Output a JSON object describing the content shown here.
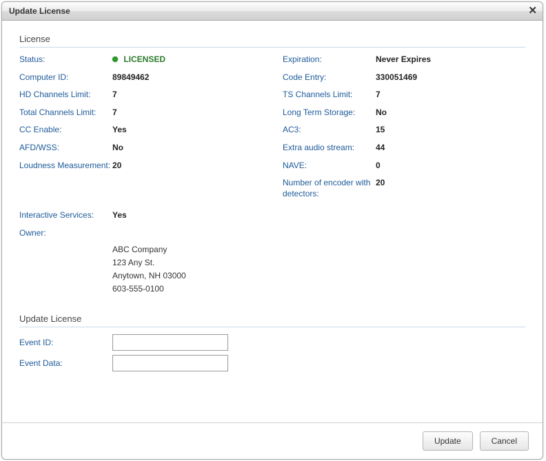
{
  "dialog": {
    "title": "Update License"
  },
  "license": {
    "section_title": "License",
    "left": {
      "status_label": "Status:",
      "status_value": "LICENSED",
      "computer_id_label": "Computer ID:",
      "computer_id_value": "89849462",
      "hd_limit_label": "HD Channels Limit:",
      "hd_limit_value": "7",
      "total_limit_label": "Total Channels Limit:",
      "total_limit_value": "7",
      "cc_enable_label": "CC Enable:",
      "cc_enable_value": "Yes",
      "afd_wss_label": "AFD/WSS:",
      "afd_wss_value": "No",
      "loudness_label": "Loudness Measurement:",
      "loudness_value": "20"
    },
    "right": {
      "expiration_label": "Expiration:",
      "expiration_value": "Never Expires",
      "code_entry_label": "Code Entry:",
      "code_entry_value": "330051469",
      "ts_limit_label": "TS Channels Limit:",
      "ts_limit_value": "7",
      "lts_label": "Long Term Storage:",
      "lts_value": "No",
      "ac3_label": "AC3:",
      "ac3_value": "15",
      "extra_audio_label": "Extra audio stream:",
      "extra_audio_value": "44",
      "nave_label": "NAVE:",
      "nave_value": "0",
      "enc_det_label": "Number of encoder with detectors:",
      "enc_det_value": "20"
    },
    "interactive_label": "Interactive Services:",
    "interactive_value": "Yes",
    "owner_label": "Owner:",
    "owner_line1": "ABC Company",
    "owner_line2": "123 Any St.",
    "owner_line3": "Anytown,  NH  03000",
    "owner_line4": "603-555-0100"
  },
  "update": {
    "section_title": "Update License",
    "event_id_label": "Event ID:",
    "event_id_value": "",
    "event_data_label": "Event Data:",
    "event_data_value": ""
  },
  "buttons": {
    "update": "Update",
    "cancel": "Cancel"
  }
}
